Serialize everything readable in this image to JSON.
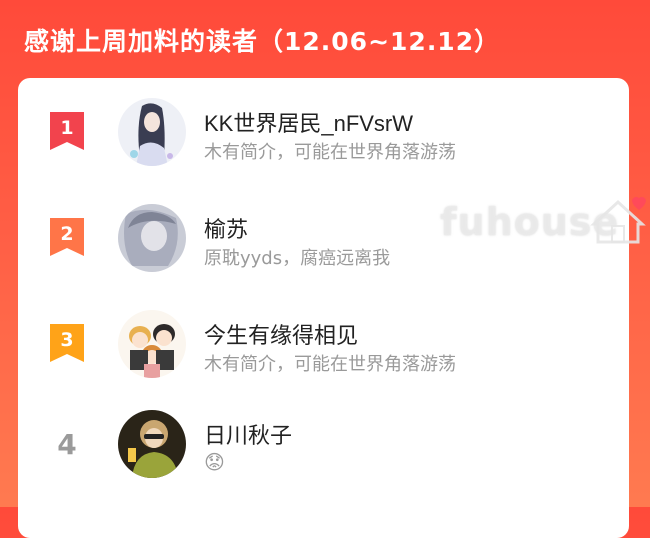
{
  "header": {
    "title": "感谢上周加料的读者（12.06~12.12）"
  },
  "colors": {
    "accent": "#ff4a3a",
    "rank1": "#f2434d",
    "rank2": "#ff7548",
    "rank3": "#ffa318"
  },
  "readers": [
    {
      "rank": "1",
      "name": "KK世界居民_nFVsrW",
      "bio": "木有简介，可能在世界角落游荡"
    },
    {
      "rank": "2",
      "name": "榆苏",
      "bio": "原耽yyds，腐癌远离我"
    },
    {
      "rank": "3",
      "name": "今生有缘得相见",
      "bio": "木有简介，可能在世界角落游荡"
    },
    {
      "rank": "4",
      "name": "日川秋子",
      "bio": "😟"
    }
  ],
  "watermark": "fuhouse"
}
